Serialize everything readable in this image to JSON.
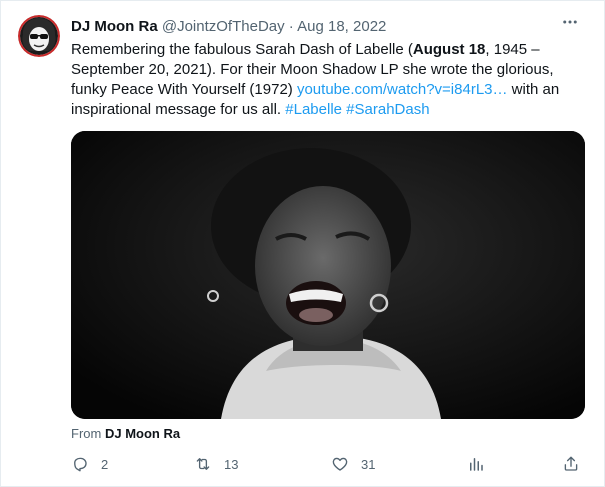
{
  "tweet": {
    "display_name": "DJ Moon Ra",
    "handle": "@JointzOfTheDay",
    "separator": "·",
    "date": "Aug 18, 2022",
    "more_icon": "more-horizontal-icon",
    "text": {
      "p1": "Remembering the fabulous Sarah Dash of Labelle (",
      "b1": "August 18",
      "p2": ", 1945 – September 20, 2021). For their Moon Shadow LP she wrote the glorious, funky Peace With Yourself (1972) ",
      "link": "youtube.com/watch?v=i84rL3…",
      "p3": " with an inspirational message for us all. ",
      "hashtag1": "#Labelle",
      "hashtag2": "#SarahDash"
    },
    "from": {
      "prefix": "From",
      "author": "DJ Moon Ra"
    },
    "actions": {
      "reply_icon": "reply-icon",
      "reply_count": "2",
      "retweet_icon": "retweet-icon",
      "retweet_count": "13",
      "like_icon": "heart-icon",
      "like_count": "31",
      "views_icon": "analytics-icon",
      "share_icon": "share-icon"
    },
    "colors": {
      "link": "#1d9bf0",
      "secondary_text": "#536471",
      "primary_text": "#0f1419"
    }
  }
}
